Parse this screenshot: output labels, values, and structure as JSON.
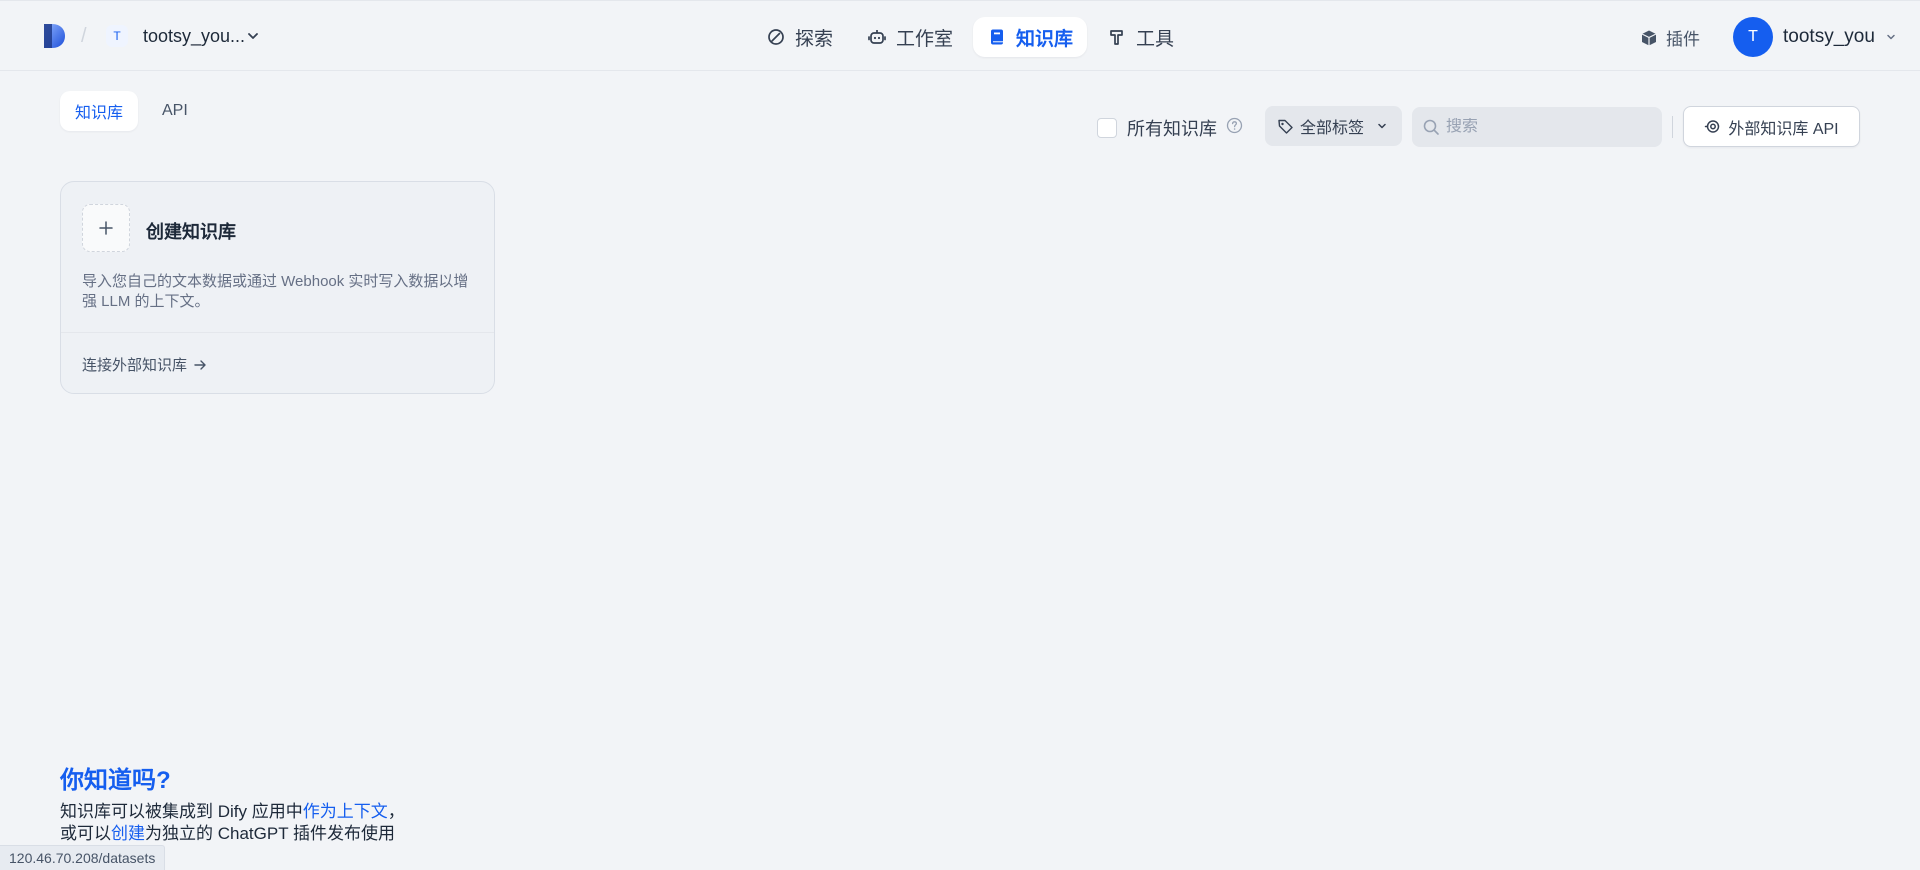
{
  "header": {
    "workspace_initial": "T",
    "workspace_name": "tootsy_you...",
    "nav": {
      "explore": "探索",
      "studio": "工作室",
      "knowledge": "知识库",
      "tools": "工具"
    },
    "plugins_label": "插件",
    "user_initial": "T",
    "user_name": "tootsy_you"
  },
  "tabs": {
    "knowledge": "知识库",
    "api": "API"
  },
  "toolbar": {
    "all_knowledge_label": "所有知识库",
    "tag_filter_label": "全部标签",
    "search_placeholder": "搜索",
    "external_api_label": "外部知识库 API"
  },
  "create_card": {
    "title": "创建知识库",
    "description": "导入您自己的文本数据或通过 Webhook 实时写入数据以增强 LLM 的上下文。",
    "connect_external": "连接外部知识库"
  },
  "tip": {
    "title": "你知道吗?",
    "line1_prefix": "知识库可以被集成到 Dify 应用中",
    "line1_link": "作为上下文",
    "line1_suffix": "，",
    "line2_prefix": "或可以",
    "line2_link": "创建",
    "line2_suffix": "为独立的 ChatGPT 插件发布使用"
  },
  "status_bar": {
    "url": "120.46.70.208/datasets"
  },
  "colors": {
    "accent": "#155eef",
    "background": "#f2f4f7"
  }
}
